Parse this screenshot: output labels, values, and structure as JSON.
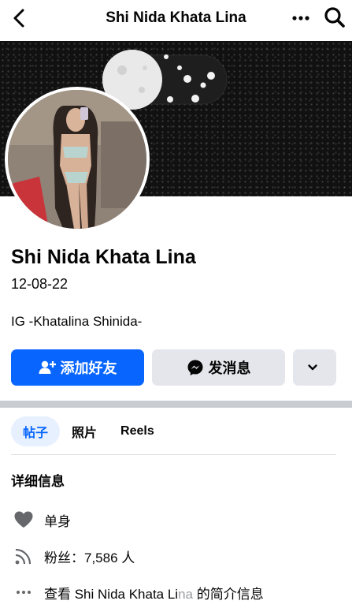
{
  "header": {
    "title": "Shi Nida Khata Lina",
    "back_icon": "back-chevron-icon",
    "more_icon": "more-dots-icon",
    "search_icon": "search-icon"
  },
  "profile": {
    "name": "Shi Nida Khata Lina",
    "date": "12-08-22",
    "bio": "IG -Khatalina Shinida-"
  },
  "actions": {
    "add_friend": "添加好友",
    "message": "发消息"
  },
  "tabs": [
    {
      "label": "帖子",
      "active": true
    },
    {
      "label": "照片",
      "active": false
    },
    {
      "label": "Reels",
      "active": false
    }
  ],
  "details": {
    "title": "详细信息",
    "relationship": "单身",
    "followers": "粉丝：7,586 人",
    "see_about_prefix": "查看 Shi Nida Khata Li",
    "see_about_faded": "na",
    "see_about_suffix": " 的简介信息"
  },
  "colors": {
    "primary": "#0866ff",
    "secondary_button": "#e4e6eb",
    "active_tab_bg": "#e7f0fe"
  }
}
